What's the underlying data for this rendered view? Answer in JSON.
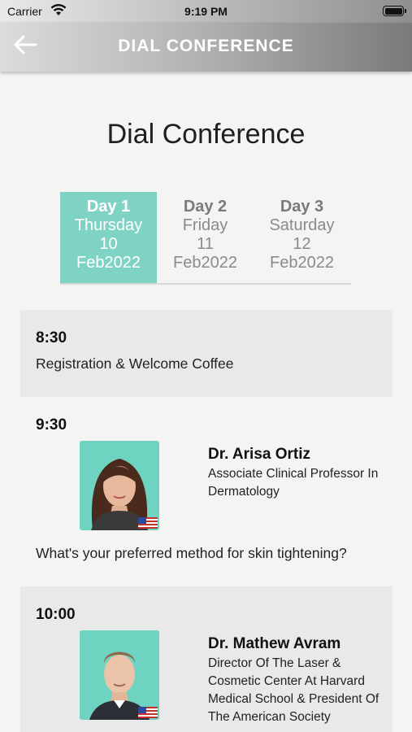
{
  "status_bar": {
    "carrier": "Carrier",
    "time": "9:19 PM"
  },
  "navbar": {
    "title": "DIAL CONFERENCE"
  },
  "page": {
    "title": "Dial Conference"
  },
  "tabs": [
    {
      "day": "Day 1",
      "weekday": "Thursday",
      "date": "10",
      "month": "Feb2022",
      "active": true
    },
    {
      "day": "Day 2",
      "weekday": "Friday",
      "date": "11",
      "month": "Feb2022",
      "active": false
    },
    {
      "day": "Day 3",
      "weekday": "Saturday",
      "date": "12",
      "month": "Feb2022",
      "active": false
    }
  ],
  "sessions": [
    {
      "time": "8:30",
      "title": "Registration & Welcome Coffee"
    },
    {
      "time": "9:30",
      "speaker": "Dr. Arisa Ortiz",
      "role": "Associate Clinical Professor In Dermatology",
      "question": "What's your preferred method for skin tightening?"
    },
    {
      "time": "10:00",
      "speaker": "Dr. Mathew Avram",
      "role": "Director Of The Laser & Cosmetic Center At Harvard Medical School & President Of The American Society"
    }
  ],
  "colors": {
    "accent": "#7fd3c4",
    "photo_bg": "#6fd3c2",
    "row_grey": "#e9e9e9"
  }
}
